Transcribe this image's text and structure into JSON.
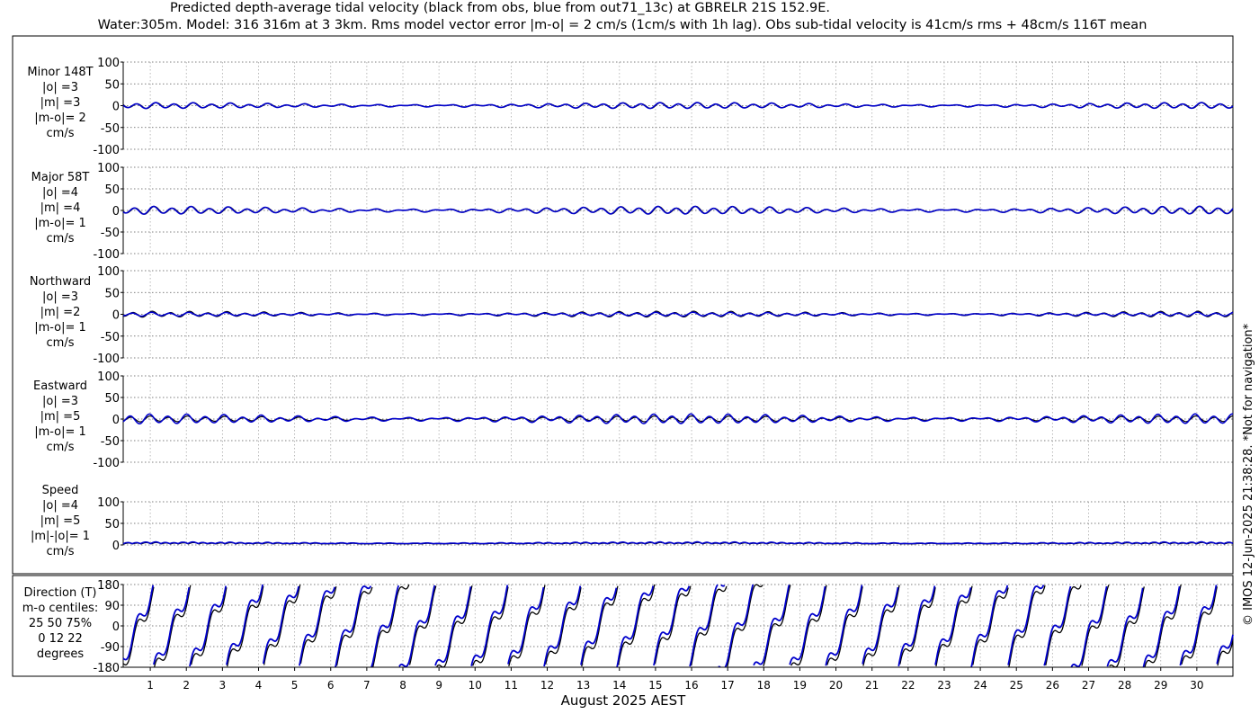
{
  "title_line1": "Predicted depth-average tidal velocity (black from obs, blue from out71_13c) at GBRELR 21S 152.9E.",
  "title_line2": "Water:305m. Model: 316 316m at 3 3km. Rms model vector error |m-o| = 2 cm/s (1cm/s with 1h lag). Obs sub-tidal velocity is 41cm/s rms + 48cm/s 116T mean",
  "x_axis_label": "August 2025 AEST",
  "side_note": "© IMOS 12-Jun-2025 21:38:28. *Not for navigation*",
  "colors": {
    "observed": "#000000",
    "model": "#0000cc"
  },
  "chart_data": {
    "type": "line",
    "title": "Predicted depth-average tidal velocity (black from obs, blue from out71_13c) at GBRELR 21S 152.9E.",
    "xlabel": "August 2025 AEST",
    "x_ticks": [
      "1",
      "2",
      "3",
      "4",
      "5",
      "6",
      "7",
      "8",
      "9",
      "10",
      "11",
      "12",
      "13",
      "14",
      "15",
      "16",
      "17",
      "18",
      "19",
      "20",
      "21",
      "22",
      "23",
      "24",
      "25",
      "26",
      "27",
      "28",
      "29",
      "30"
    ],
    "xlim": [
      0.25,
      31.0
    ],
    "grid": true,
    "panels": [
      {
        "label_lines": [
          "Minor 148T",
          "|o| =3",
          "|m| =3",
          "|m-o|= 2",
          "cm/s"
        ],
        "yticks": [
          "100",
          "50",
          "0",
          "-50",
          "-100"
        ],
        "ylim": [
          -100,
          100
        ],
        "amplitude": {
          "observed": 3,
          "model": 3
        }
      },
      {
        "label_lines": [
          "Major 58T",
          "|o| =4",
          "|m| =4",
          "|m-o|= 1",
          "cm/s"
        ],
        "yticks": [
          "100",
          "50",
          "0",
          "-50",
          "-100"
        ],
        "ylim": [
          -100,
          100
        ],
        "amplitude": {
          "observed": 4,
          "model": 4
        }
      },
      {
        "label_lines": [
          "Northward",
          "|o| =3",
          "|m| =2",
          "|m-o|= 1",
          "cm/s"
        ],
        "yticks": [
          "100",
          "50",
          "0",
          "-50",
          "-100"
        ],
        "ylim": [
          -100,
          100
        ],
        "amplitude": {
          "observed": 3,
          "model": 2
        }
      },
      {
        "label_lines": [
          "Eastward",
          "|o| =3",
          "|m| =5",
          "|m-o|= 1",
          "cm/s"
        ],
        "yticks": [
          "100",
          "50",
          "0",
          "-50",
          "-100"
        ],
        "ylim": [
          -100,
          100
        ],
        "amplitude": {
          "observed": 3,
          "model": 5
        }
      },
      {
        "label_lines": [
          "Speed",
          "|o| =4",
          "|m| =5",
          "|m|-|o|= 1",
          "cm/s"
        ],
        "yticks": [
          "100",
          "50",
          "0"
        ],
        "ylim": [
          0,
          100
        ],
        "amplitude": {
          "observed": 4,
          "model": 5
        }
      },
      {
        "label_lines": [
          "Direction (T)",
          "m-o centiles:",
          "25  50  75%",
          "0  12  22",
          "degrees"
        ],
        "yticks": [
          "180",
          "90",
          "0",
          "-90",
          "-180"
        ],
        "ylim": [
          -180,
          180
        ]
      }
    ]
  }
}
